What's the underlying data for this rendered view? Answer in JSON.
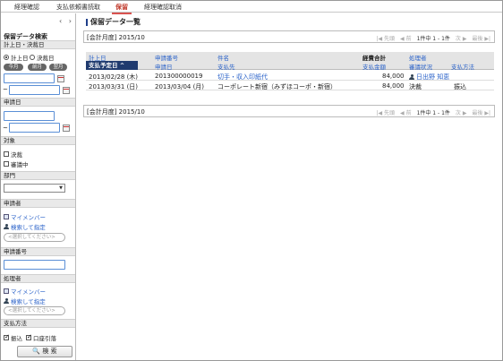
{
  "tabs": [
    "経理確認",
    "支払依頼書読取",
    "保留",
    "経理確認取消"
  ],
  "active_tab": 2,
  "sidebar": {
    "nav_prev": "‹",
    "nav_next": "›",
    "title": "保留データ検索",
    "date_section": "計上日・決裁日",
    "radio_posting": "計上日",
    "radio_approval": "決裁日",
    "btn_today": "今月",
    "btn_prev": "前月",
    "btn_next": "翌月",
    "tilde": "~",
    "apply_date_section": "申請日",
    "target_section": "対象",
    "chk_approved": "決裁",
    "chk_in_review": "審議中",
    "dept_section": "部門",
    "applicant_section": "申請者",
    "applicant_my_member": "マイメンバー",
    "applicant_search": "検索して指定",
    "applicant_placeholder": "<選択してください>",
    "apply_no_section": "申請番号",
    "processor_section": "処理者",
    "processor_my_member": "マイメンバー",
    "processor_search": "検索して指定",
    "processor_placeholder": "<選択してください>",
    "payment_section": "支払方法",
    "chk_transfer": "振込",
    "chk_debit": "口座引落",
    "search_btn": "検 索"
  },
  "main": {
    "page_title": "保留データ一覧",
    "period_label": "[会計月度] 2015/10",
    "pager": {
      "first": "|◀ 先頭",
      "prev": "◀ 前",
      "range": "1件中 1 - 1件",
      "next": "次 ▶",
      "last": "最後 ▶|"
    },
    "columns_top": [
      "計上日",
      "申請番号",
      "件名",
      "",
      "経費合計",
      "処理者"
    ],
    "columns_bottom": [
      "支払予定日 ^",
      "申請日",
      "支払先",
      "",
      "支払金額",
      "審議状況",
      "支払方法"
    ],
    "rows": [
      {
        "date": "2013/02/28 (木)",
        "number": "201300000019",
        "subject": "切手・収入印紙代",
        "amount": "84,000",
        "processor": "日出野 知恵",
        "status": "",
        "method": ""
      },
      {
        "date": "2013/03/31 (日)",
        "number": "2013/03/04 (月)",
        "subject": "コーポレート新宿（みずほコーポ・新宿）",
        "amount": "84,000",
        "processor": "",
        "status": "決裁",
        "method": "振込"
      }
    ]
  },
  "colors": {
    "accent": "#1f3a6e",
    "link": "#2a62c9",
    "active_tab": "#c0392b"
  }
}
